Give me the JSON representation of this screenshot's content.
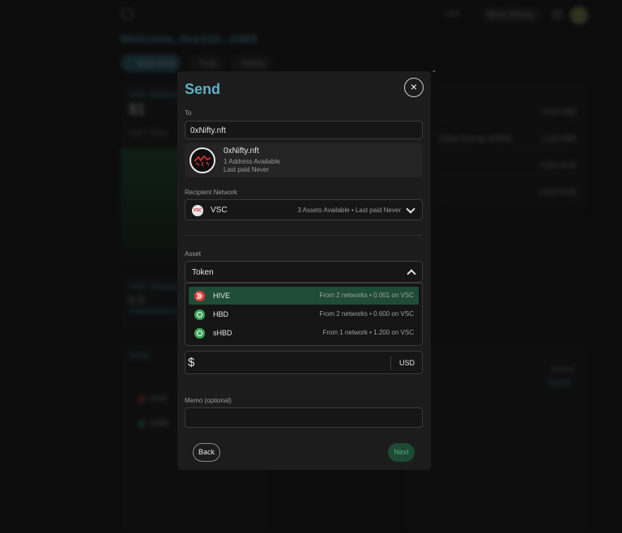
{
  "background": {
    "welcome": "Welcome, 0xe102...0365",
    "currency": "USD",
    "account_menu": "Move Money",
    "tabs": [
      "Quick Send",
      "Trade",
      "Staking"
    ],
    "balance_card": {
      "title": "VSC Balance",
      "amount": "$1",
      "subtitle": "Last 7 Days"
    },
    "assets_rows": [
      {
        "label": "",
        "value": "0.600 HBD"
      },
      {
        "label": "Dollar Savings (sHBD)",
        "value": "1.200 HBD"
      },
      {
        "label": "",
        "value": "0.001 HIVE"
      },
      {
        "label": "",
        "value": "0.000 HIVE"
      }
    ],
    "resource_card": {
      "title": "VSC Resour",
      "amount": "0.0"
    },
    "send_card": {
      "title": "Send",
      "items": [
        "HIVE",
        "sHBD"
      ]
    },
    "right_card": {
      "title": "Submit",
      "action": "Send"
    }
  },
  "modal": {
    "title": "Send",
    "close_icon": "×",
    "to": {
      "label": "To",
      "value": "0xNifty.nft"
    },
    "recipient": {
      "name": "0xNifty.nft",
      "addresses": "1 Address Available",
      "last_paid": "Last paid Never"
    },
    "network": {
      "label": "Recipient Network",
      "logo_text": "VSC",
      "name": "VSC",
      "meta": "3 Assets Available  •  Last paid Never"
    },
    "asset": {
      "label": "Asset",
      "value": "Token",
      "options": [
        {
          "icon": "hive-icon",
          "name": "HIVE",
          "meta": "From 2 networks  •  0.001 on VSC",
          "selected": true
        },
        {
          "icon": "hbd-icon",
          "name": "HBD",
          "meta": "From 2 networks  •  0.600 on VSC",
          "selected": false
        },
        {
          "icon": "shbd-icon",
          "name": "sHBD",
          "meta": "From 1 network  •  1.200 on VSC",
          "selected": false
        }
      ]
    },
    "amount": {
      "currency_symbol": "$",
      "value": "",
      "unit": "USD"
    },
    "memo": {
      "label": "Memo (optional)",
      "value": ""
    },
    "buttons": {
      "back": "Back",
      "next": "Next"
    }
  },
  "colors": {
    "accent": "#5fb0c6",
    "selected_bg": "#1f4c37",
    "hive": "#e23d3d",
    "hbd": "#3ba55b",
    "next_bg": "#1c4a34"
  }
}
